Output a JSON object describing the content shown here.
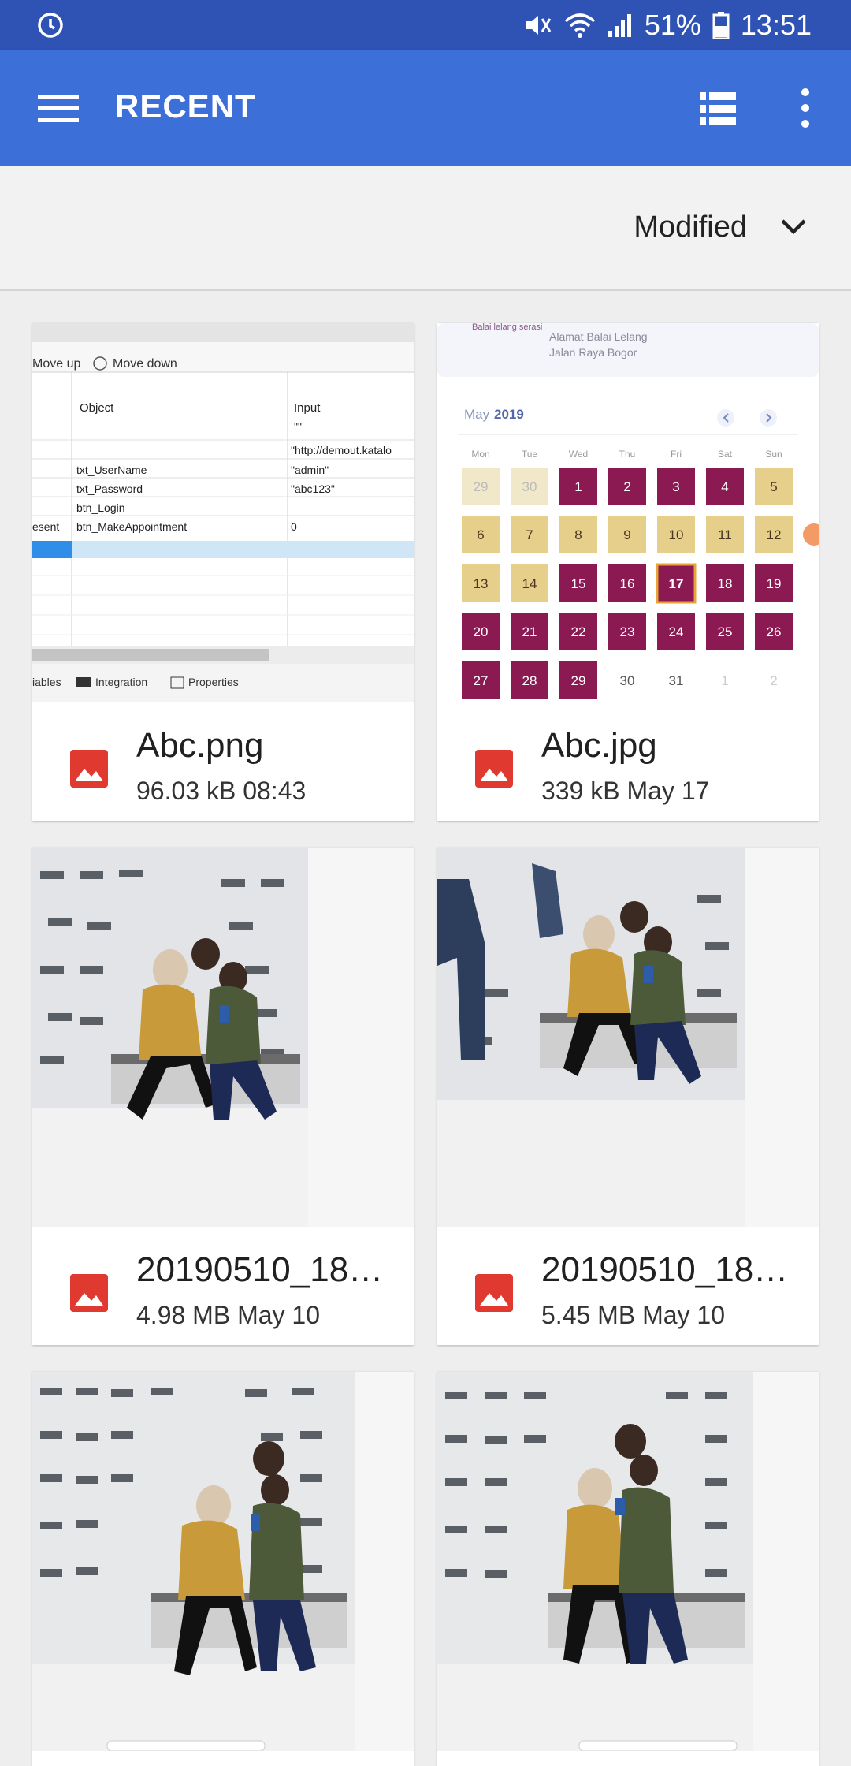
{
  "status_bar": {
    "battery": "51%",
    "time": "13:51"
  },
  "app_bar": {
    "title": "RECENT"
  },
  "sort": {
    "label": "Modified"
  },
  "files": [
    {
      "name": "Abc.png",
      "size": "96.03 kB",
      "date": "08:43"
    },
    {
      "name": "Abc.jpg",
      "size": "339 kB",
      "date": "May 17"
    },
    {
      "name": "20190510_18…",
      "size": "4.98 MB",
      "date": "May 10"
    },
    {
      "name": "20190510_18…",
      "size": "5.45 MB",
      "date": "May 10"
    }
  ],
  "thumb_png": {
    "toolbar": [
      "Move up",
      "Move down"
    ],
    "headers": [
      "Object",
      "Input"
    ],
    "rows": [
      [
        "",
        "",
        "\"\""
      ],
      [
        "",
        "",
        "\"http://demout.katalo"
      ],
      [
        "",
        "txt_UserName",
        "\"admin\""
      ],
      [
        "",
        "txt_Password",
        "\"abc123\""
      ],
      [
        "",
        "btn_Login",
        ""
      ],
      [
        "esent",
        "btn_MakeAppointment",
        "0"
      ]
    ],
    "tabs": [
      "iables",
      "Integration",
      "Properties"
    ]
  },
  "thumb_jpg": {
    "header_lines": [
      "Balai lelang serasi",
      "Alamat Balai Lelang",
      "Jalan Raya Bogor"
    ],
    "month": "May",
    "year": "2019",
    "weekdays": [
      "Mon",
      "Tue",
      "Wed",
      "Thu",
      "Fri",
      "Sat",
      "Sun"
    ],
    "days": [
      "29",
      "30",
      "1",
      "2",
      "3",
      "4",
      "5",
      "6",
      "7",
      "8",
      "9",
      "10",
      "11",
      "12",
      "13",
      "14",
      "15",
      "16",
      "17",
      "18",
      "19",
      "20",
      "21",
      "22",
      "23",
      "24",
      "25",
      "26",
      "27",
      "28",
      "29",
      "30",
      "31",
      "1",
      "2"
    ]
  },
  "colors": {
    "status_bar": "#2f52b5",
    "app_bar": "#3c6fd8",
    "image_icon": "#e0392f",
    "cal_maroon": "#8b1a52",
    "cal_tan": "#e6cf8a"
  },
  "icons": {
    "menu": "hamburger-icon",
    "view": "list-view-icon",
    "more": "more-vert-icon",
    "sort": "chevron-down-icon",
    "file": "image-icon"
  }
}
